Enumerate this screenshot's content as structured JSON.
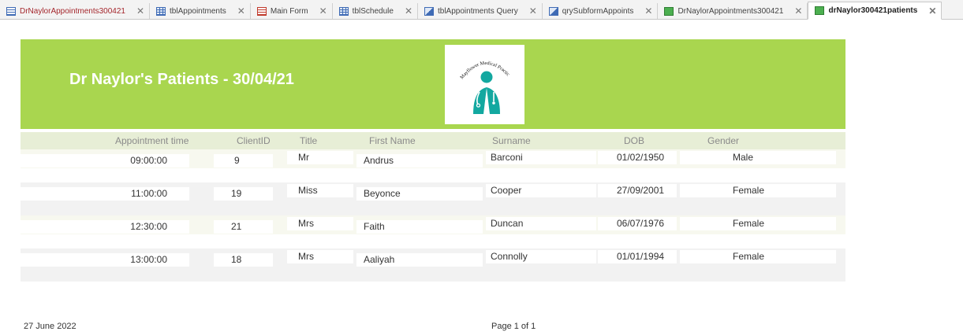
{
  "tabs": [
    {
      "label": "DrNaylorAppointments300421",
      "icon": "form-icon"
    },
    {
      "label": "tblAppointments",
      "icon": "table-icon"
    },
    {
      "label": "Main Form",
      "icon": "main-form-icon"
    },
    {
      "label": "tblSchedule",
      "icon": "table-icon"
    },
    {
      "label": "tblAppointments Query",
      "icon": "query-icon"
    },
    {
      "label": "qrySubformAppoints",
      "icon": "query-icon"
    },
    {
      "label": "DrNaylorAppointments300421",
      "icon": "report-icon"
    },
    {
      "label": "drNaylor300421patients",
      "icon": "report-icon"
    }
  ],
  "report": {
    "title": "Dr Naylor's Patients - 30/04/21",
    "logo_text": "Mayflower Medical Practice",
    "columns": [
      "Appointment time",
      "ClientID",
      "Title",
      "First Name",
      "Surname",
      "DOB",
      "Gender"
    ],
    "rows": [
      {
        "time": "09:00:00",
        "client_id": "9",
        "title": "Mr",
        "first_name": "Andrus",
        "surname": "Barconi",
        "dob": "01/02/1950",
        "gender": "Male"
      },
      {
        "time": "11:00:00",
        "client_id": "19",
        "title": "Miss",
        "first_name": "Beyonce",
        "surname": "Cooper",
        "dob": "27/09/2001",
        "gender": "Female"
      },
      {
        "time": "12:30:00",
        "client_id": "21",
        "title": "Mrs",
        "first_name": "Faith",
        "surname": "Duncan",
        "dob": "06/07/1976",
        "gender": "Female"
      },
      {
        "time": "13:00:00",
        "client_id": "18",
        "title": "Mrs",
        "first_name": "Aaliyah",
        "surname": "Connolly",
        "dob": "01/01/1994",
        "gender": "Female"
      }
    ],
    "footer_date": "27 June 2022",
    "footer_page": "Page 1 of 1"
  },
  "colors": {
    "header_green": "#a9d64f",
    "logo_teal": "#13a8a0",
    "tab_first_red": "#a4262c"
  }
}
